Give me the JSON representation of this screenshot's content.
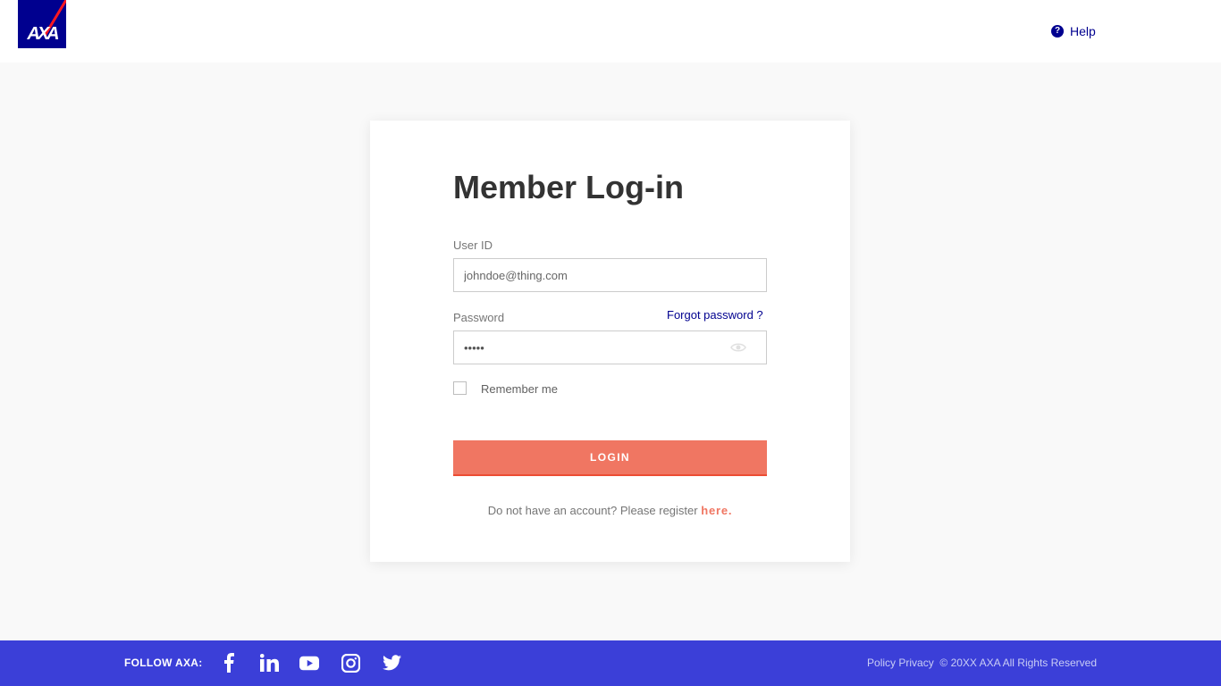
{
  "header": {
    "logo_text": "AXA",
    "help_label": "Help",
    "help_icon": "question-circle-icon"
  },
  "login": {
    "title": "Member Log-in",
    "user_id_label": "User ID",
    "user_id_placeholder": "johndoe@thing.com",
    "password_label": "Password",
    "password_value": "•••••",
    "forgot_label": "Forgot password ?",
    "remember_label": "Remember me",
    "login_button": "LOGIN",
    "register_text": "Do not have an account? Please register ",
    "register_link": "here."
  },
  "footer": {
    "follow_label": "FOLLOW AXA:",
    "social_icons": [
      "facebook-icon",
      "linkedin-icon",
      "youtube-icon",
      "instagram-icon",
      "twitter-icon"
    ],
    "policy_label": "Policy Privacy",
    "copyright": "© 20XX AXA All Rights Reserved"
  },
  "colors": {
    "brand_blue": "#00008f",
    "footer_blue": "#3b3fd8",
    "accent_coral": "#f07662",
    "background": "#f9f9f9"
  }
}
